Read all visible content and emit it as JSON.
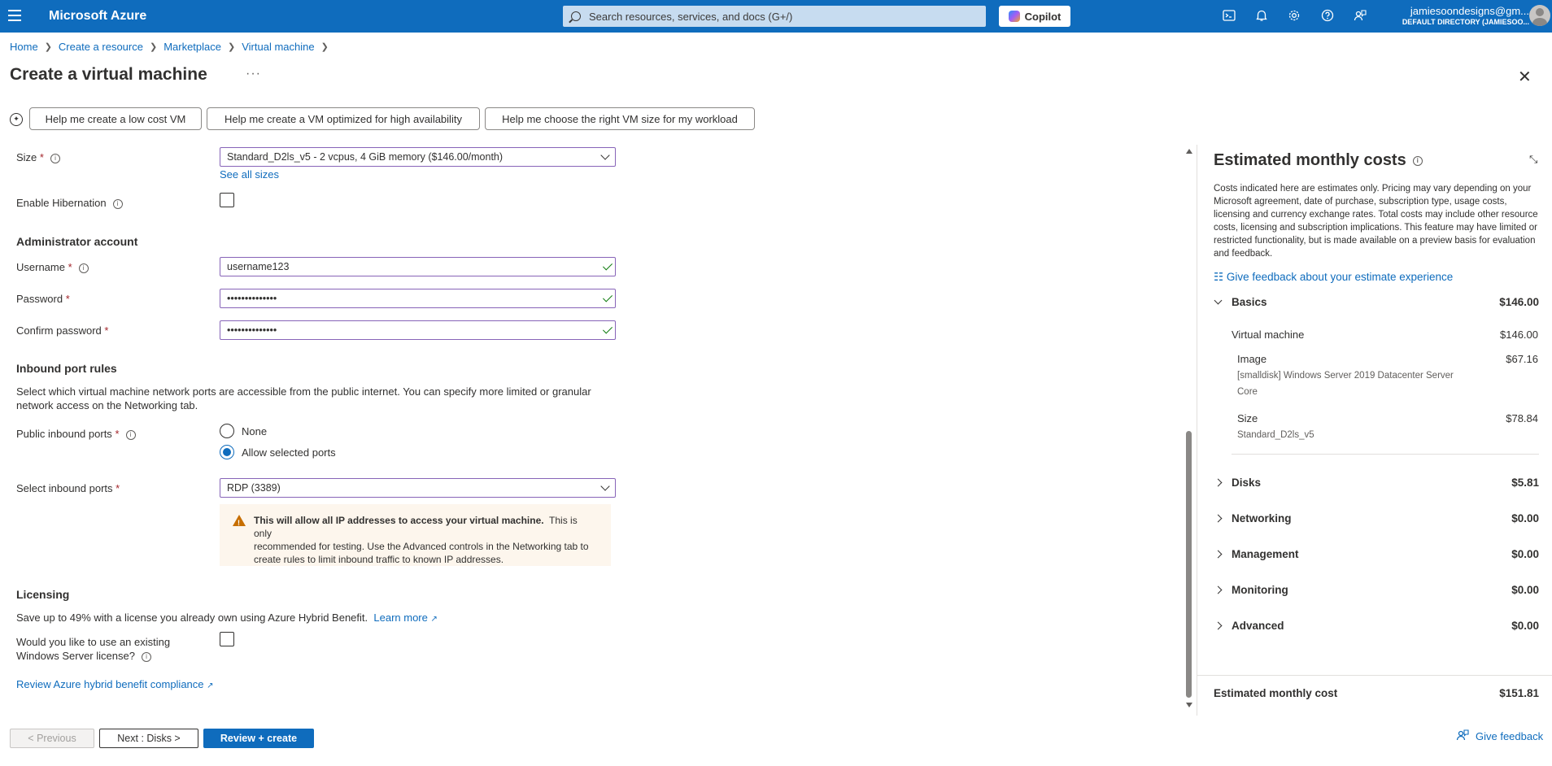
{
  "topbar": {
    "brand": "Microsoft Azure",
    "search_placeholder": "Search resources, services, and docs (G+/)",
    "copilot_label": "Copilot",
    "user_email": "jamiesoondesigns@gm...",
    "user_directory": "DEFAULT DIRECTORY (JAMIESOO..."
  },
  "breadcrumb": [
    "Home",
    "Create a resource",
    "Marketplace",
    "Virtual machine"
  ],
  "page_title": "Create a virtual machine",
  "helper_buttons": [
    "Help me create a low cost VM",
    "Help me create a VM optimized for high availability",
    "Help me choose the right VM size for my workload"
  ],
  "form": {
    "size_label": "Size",
    "size_value": "Standard_D2ls_v5 - 2 vcpus, 4 GiB memory ($146.00/month)",
    "see_all_sizes": "See all sizes",
    "hibernation_label": "Enable Hibernation",
    "admin_heading": "Administrator account",
    "username_label": "Username",
    "username_value": "username123",
    "password_label": "Password",
    "password_value": "••••••••••••••",
    "confirm_label": "Confirm password",
    "confirm_value": "••••••••••••••",
    "inbound_heading": "Inbound port rules",
    "inbound_desc_1": "Select which virtual machine network ports are accessible from the public internet. You can specify more limited or granular",
    "inbound_desc_2": "network access on the Networking tab.",
    "public_ports_label": "Public inbound ports",
    "radio_none": "None",
    "radio_allow": "Allow selected ports",
    "select_ports_label": "Select inbound ports",
    "select_ports_value": "RDP (3389)",
    "warning_bold": "This will allow all IP addresses to access your virtual machine.",
    "warning_text_1": "This is only",
    "warning_text_2": "recommended for testing.  Use the Advanced controls in the Networking tab to",
    "warning_text_3": "create rules to limit inbound traffic to known IP addresses.",
    "licensing_heading": "Licensing",
    "licensing_desc": "Save up to 49% with a license you already own using Azure Hybrid Benefit.",
    "learn_more": "Learn more",
    "existing_license_1": "Would you like to use an existing",
    "existing_license_2": "Windows Server license?",
    "review_compliance": "Review Azure hybrid benefit compliance"
  },
  "costs": {
    "title": "Estimated monthly costs",
    "description": "Costs indicated here are estimates only. Pricing may vary depending on your Microsoft agreement, date of purchase, subscription type, usage costs, licensing and currency exchange rates. Total costs may include other resource costs, licensing and subscription implications. This feature may have limited or restricted functionality, but is made available on a preview basis for evaluation and feedback.",
    "feedback_link": "Give feedback about your estimate experience",
    "basics_label": "Basics",
    "basics_amount": "$146.00",
    "vm_label": "Virtual machine",
    "vm_amount": "$146.00",
    "image_label": "Image",
    "image_amount": "$67.16",
    "image_detail_1": "[smalldisk] Windows Server 2019 Datacenter Server",
    "image_detail_2": "Core",
    "size_label": "Size",
    "size_amount": "$78.84",
    "size_detail": "Standard_D2ls_v5",
    "categories": [
      {
        "name": "Disks",
        "amount": "$5.81"
      },
      {
        "name": "Networking",
        "amount": "$0.00"
      },
      {
        "name": "Management",
        "amount": "$0.00"
      },
      {
        "name": "Monitoring",
        "amount": "$0.00"
      },
      {
        "name": "Advanced",
        "amount": "$0.00"
      }
    ],
    "total_label": "Estimated monthly cost",
    "total_amount": "$151.81"
  },
  "bottom": {
    "previous": "< Previous",
    "next": "Next : Disks >",
    "review": "Review + create",
    "feedback": "Give feedback"
  },
  "colors": {
    "brand_blue": "#0f6cbd",
    "field_border": "#8764b8",
    "valid_green": "#107c10",
    "warning_orange": "#c76e00"
  }
}
